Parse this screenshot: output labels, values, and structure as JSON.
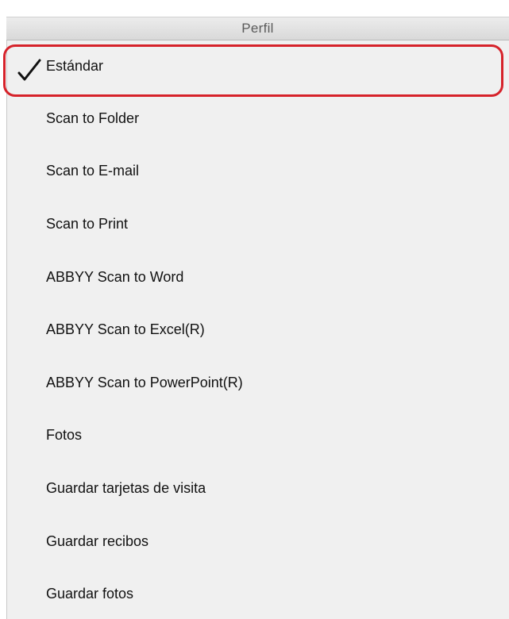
{
  "menu": {
    "header": "Perfil",
    "items": [
      {
        "label": "Estándar",
        "checked": true
      },
      {
        "label": "Scan to Folder"
      },
      {
        "label": "Scan to E-mail"
      },
      {
        "label": "Scan to Print"
      },
      {
        "label": "ABBYY Scan to Word"
      },
      {
        "label": "ABBYY Scan to Excel(R)"
      },
      {
        "label": "ABBYY Scan to PowerPoint(R)"
      },
      {
        "label": "Fotos"
      },
      {
        "label": "Guardar tarjetas de visita"
      },
      {
        "label": "Guardar recibos"
      },
      {
        "label": "Guardar fotos"
      }
    ]
  },
  "icons": {
    "checked": "checkmark-icon"
  },
  "colors": {
    "highlight_outline": "#d6222a",
    "menu_background": "#f0f0f0"
  }
}
